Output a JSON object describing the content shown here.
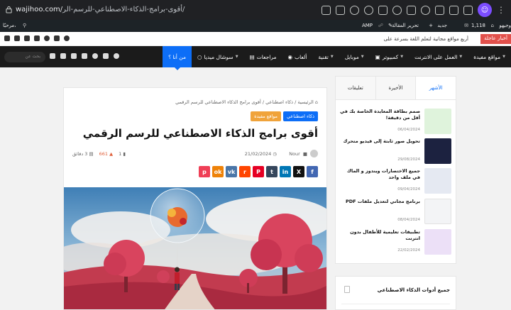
{
  "browser": {
    "url_domain": "wajihoo.com/",
    "url_path": "أقوى-برامج-الذكاء-الاصطناعي-للرسم-الر/",
    "icons": [
      "reader-icon",
      "translate-icon",
      "search-icon",
      "zoom-icon",
      "camera-icon",
      "shield-icon",
      "extension-icon",
      "heart-icon",
      "battery-icon",
      "download-icon",
      "sidebar-icon"
    ]
  },
  "wpbar": {
    "site": "وجيهو",
    "comments": "1,118",
    "edit": "تحرير المقالة",
    "new": "جديد",
    "amp": "AMP",
    "greeting": "مرحبًا،"
  },
  "topbar": {
    "breaking_label": "أخبار عاجلة",
    "breaking_text": "أربع مواقع مجانية لتعلم اللغة بسرعة على"
  },
  "nav": {
    "items": [
      {
        "label": "مواقع مفيدة",
        "caret": true
      },
      {
        "label": "العمل على الانترنت",
        "caret": true
      },
      {
        "label": "كمبيوتر",
        "caret": true
      },
      {
        "label": "موبايل",
        "caret": true
      },
      {
        "label": "تقنية",
        "caret": true
      },
      {
        "label": "ألعاب",
        "caret": false
      },
      {
        "label": "مراجعات",
        "caret": false
      },
      {
        "label": "سوشال ميديا",
        "caret": true
      },
      {
        "label": "من أنا ؟",
        "caret": false
      }
    ],
    "search_placeholder": "بحث عن"
  },
  "article": {
    "breadcrumb": "الرئيسية / ذكاء اصطناعي / أقوى برامج الذكاء الاصطناعي للرسم الرقمي",
    "categories": [
      {
        "label": "ذكاء اصطناعي",
        "color": "#0d6ef7"
      },
      {
        "label": "مواقع مفيدة",
        "color": "#f0a33a"
      }
    ],
    "title": "أقوى برامج الذكاء الاصطناعي للرسم الرقمي",
    "author": "Nour",
    "date": "21/02/2024",
    "comments": "1",
    "views": "661",
    "read_time": "3 دقائق",
    "share_buttons": [
      {
        "name": "facebook",
        "color": "#4267b2",
        "glyph": "f"
      },
      {
        "name": "x",
        "color": "#111111",
        "glyph": "X"
      },
      {
        "name": "linkedin",
        "color": "#0077b5",
        "glyph": "in"
      },
      {
        "name": "tumblr",
        "color": "#35465c",
        "glyph": "t"
      },
      {
        "name": "pinterest",
        "color": "#e60023",
        "glyph": "P"
      },
      {
        "name": "reddit",
        "color": "#ff4500",
        "glyph": "r"
      },
      {
        "name": "vk",
        "color": "#4a76a8",
        "glyph": "vk"
      },
      {
        "name": "odnoklassniki",
        "color": "#ee8208",
        "glyph": "ok"
      },
      {
        "name": "pocket",
        "color": "#ef3f56",
        "glyph": "p"
      }
    ]
  },
  "sidebar": {
    "tabs": [
      "الأشهر",
      "الأخيرة",
      "تعليقات"
    ],
    "posts": [
      {
        "title": "صمم بطاقة المعايدة الخاصة بك في أقل من دقيقة!",
        "date": "06/04/2024",
        "color": "#dff3dc"
      },
      {
        "title": "تحويل صور ثابتة إلى فيديو متحرك",
        "date": "29/08/2024",
        "color": "#1c2240"
      },
      {
        "title": "جميع الاختصارات ويندوز و الماك في ملف واحد",
        "date": "09/04/2024",
        "color": "#e5e9f2"
      },
      {
        "title": "برنامج مجاني لتعديل ملفات PDF",
        "date": "08/04/2024",
        "color": "#f3f4f6"
      },
      {
        "title": "تطبيقات تعليمية للأطفال بدون انترنت",
        "date": "22/02/2024",
        "color": "#ece0f7"
      }
    ]
  },
  "widget": {
    "title": "جميع أدوات الذكاء الاصطناعي"
  }
}
